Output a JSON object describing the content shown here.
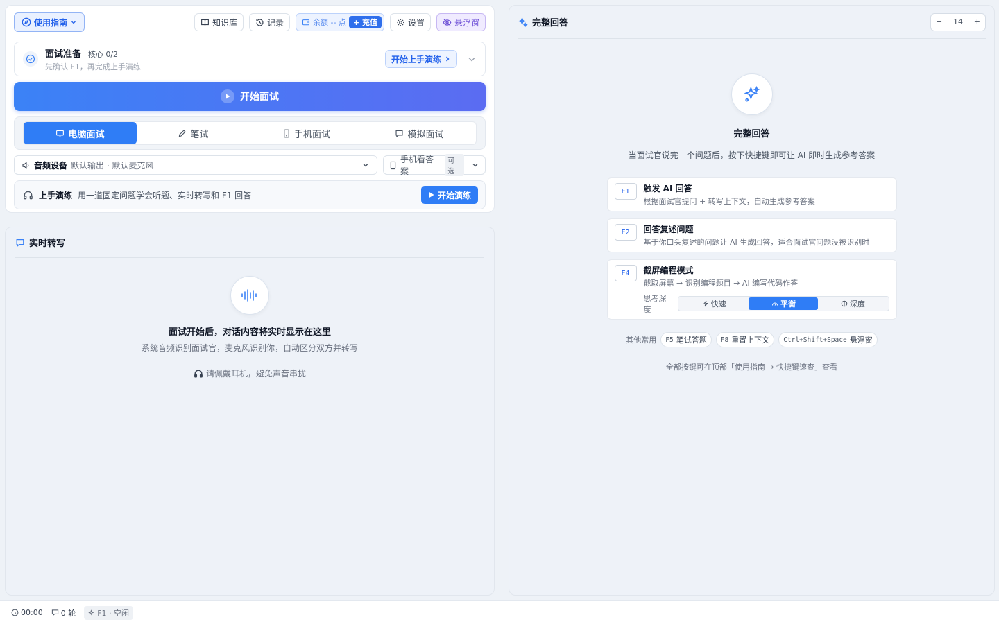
{
  "toolbar": {
    "guide_label": "使用指南",
    "kb_label": "知识库",
    "history_label": "记录",
    "balance_label": "余额 -- 点",
    "recharge_label": "+ 充值",
    "settings_label": "设置",
    "float_label": "悬浮窗"
  },
  "prep": {
    "title": "面试准备",
    "core": "核心 0/2",
    "subtitle": "先确认 F1，再完成上手演练",
    "start_label": "开始上手演练"
  },
  "start_interview_label": "开始面试",
  "modes": [
    {
      "label": "电脑面试",
      "active": true
    },
    {
      "label": "笔试",
      "active": false
    },
    {
      "label": "手机面试",
      "active": false
    },
    {
      "label": "模拟面试",
      "active": false
    }
  ],
  "audio": {
    "label": "音频设备",
    "value": "默认输出 · 默认麦克风"
  },
  "phone_answer": {
    "label": "手机看答案",
    "optional": "可选"
  },
  "practice": {
    "title": "上手演练",
    "desc": "用一道固定问题学会听题、实时转写和 F1 回答",
    "button": "开始演练"
  },
  "transcript": {
    "title": "实时转写",
    "empty_title": "面试开始后，对话内容将实时显示在这里",
    "empty_sub": "系统音频识别面试官，麦克风识别你，自动区分双方并转写",
    "tip": "请佩戴耳机，避免声音串扰"
  },
  "answer": {
    "title": "完整回答",
    "zoom_value": "14",
    "empty_title": "完整回答",
    "empty_sub": "当面试官说完一个问题后，按下快捷键即可让 AI 即时生成参考答案",
    "keys": [
      {
        "key": "F1",
        "title": "触发 AI 回答",
        "desc": "根据面试官提问 + 转写上下文，自动生成参考答案"
      },
      {
        "key": "F2",
        "title": "回答复述问题",
        "desc": "基于你口头复述的问题让 AI 生成回答，适合面试官问题没被识别时"
      },
      {
        "key": "F4",
        "title": "截屏编程模式",
        "desc": "截取屏幕 → 识别编程题目 → AI 编写代码作答"
      }
    ],
    "depth_label": "思考深度",
    "depth_options": [
      {
        "label": "快速",
        "active": false
      },
      {
        "label": "平衡",
        "active": true
      },
      {
        "label": "深度",
        "active": false
      }
    ],
    "others_label": "其他常用",
    "others": [
      {
        "key": "F5",
        "label": "笔试答题"
      },
      {
        "key": "F8",
        "label": "重置上下文"
      },
      {
        "key": "Ctrl+Shift+Space",
        "label": "悬浮窗"
      }
    ],
    "foot_tip": "全部按键可在顶部「使用指南 → 快捷键速查」查看"
  },
  "status": {
    "time": "00:00",
    "rounds": "0 轮",
    "state": "F1 · 空闲"
  },
  "colors": {
    "primary": "#2f7df6",
    "float_accent": "#6d4fd6"
  }
}
